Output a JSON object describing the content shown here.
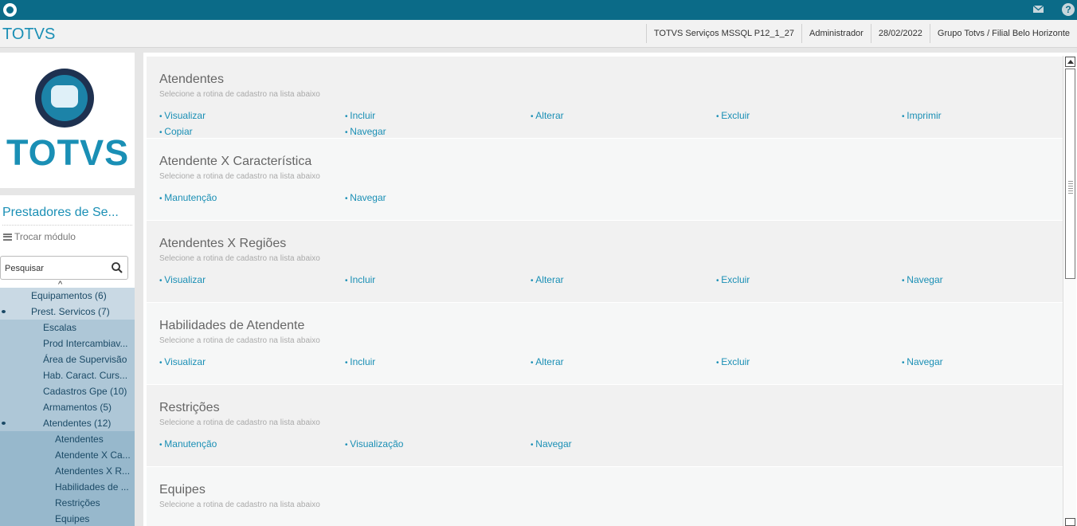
{
  "topbar": {
    "icons": [
      "totvs-logo-icon",
      "mail-icon",
      "help-icon"
    ],
    "help_glyph": "?"
  },
  "header": {
    "brand": "TOTVS",
    "environment": "TOTVS Serviços MSSQL P12_1_27",
    "user": "Administrador",
    "date": "28/02/2022",
    "branch": "Grupo Totvs / Filial Belo Horizonte"
  },
  "sidebar": {
    "logo_text": "TOTVS",
    "module_title": "Prestadores de Se...",
    "switch_label": "Trocar módulo",
    "search": {
      "value": "Pesquisar",
      "placeholder": "Pesquisar"
    },
    "tree": [
      {
        "label": "Equipamentos (6)",
        "level": 1,
        "expanded": false
      },
      {
        "label": "Prest. Servicos (7)",
        "level": 1,
        "expanded": true
      },
      {
        "label": "Escalas",
        "level": 2,
        "expanded": false
      },
      {
        "label": "Prod Intercambiav...",
        "level": 2,
        "expanded": false
      },
      {
        "label": "Área de Supervisão",
        "level": 2,
        "expanded": false
      },
      {
        "label": "Hab. Caract. Curs...",
        "level": 2,
        "expanded": false
      },
      {
        "label": "Cadastros Gpe (10)",
        "level": 2,
        "expanded": false
      },
      {
        "label": "Armamentos (5)",
        "level": 2,
        "expanded": false
      },
      {
        "label": "Atendentes (12)",
        "level": 2,
        "expanded": true
      },
      {
        "label": "Atendentes",
        "level": 3,
        "expanded": false
      },
      {
        "label": "Atendente X Ca...",
        "level": 3,
        "expanded": false
      },
      {
        "label": "Atendentes X R...",
        "level": 3,
        "expanded": false
      },
      {
        "label": "Habilidades de ...",
        "level": 3,
        "expanded": false
      },
      {
        "label": "Restrições",
        "level": 3,
        "expanded": false
      },
      {
        "label": "Equipes",
        "level": 3,
        "expanded": false
      }
    ]
  },
  "main": {
    "sections": [
      {
        "title": "Atendentes",
        "subtitle": "Selecione a rotina de cadastro na lista abaixo",
        "links": [
          "Visualizar",
          "Incluir",
          "Alterar",
          "Excluir",
          "Imprimir",
          "Copiar",
          "Navegar"
        ]
      },
      {
        "title": "Atendente X Característica",
        "subtitle": "Selecione a rotina de cadastro na lista abaixo",
        "links": [
          "Manutenção",
          "Navegar"
        ]
      },
      {
        "title": "Atendentes X Regiões",
        "subtitle": "Selecione a rotina de cadastro na lista abaixo",
        "links": [
          "Visualizar",
          "Incluir",
          "Alterar",
          "Excluir",
          "Navegar"
        ]
      },
      {
        "title": "Habilidades de Atendente",
        "subtitle": "Selecione a rotina de cadastro na lista abaixo",
        "links": [
          "Visualizar",
          "Incluir",
          "Alterar",
          "Excluir",
          "Navegar"
        ]
      },
      {
        "title": "Restrições",
        "subtitle": "Selecione a rotina de cadastro na lista abaixo",
        "links": [
          "Manutenção",
          "Visualização",
          "Navegar"
        ]
      },
      {
        "title": "Equipes",
        "subtitle": "Selecione a rotina de cadastro na lista abaixo",
        "links": []
      }
    ]
  },
  "colors": {
    "topbar": "#0b6b88",
    "accent": "#1a8fb5",
    "tree_l1": "#c9d9e4",
    "tree_l2": "#aec7d7",
    "tree_l3": "#97b8cc"
  }
}
